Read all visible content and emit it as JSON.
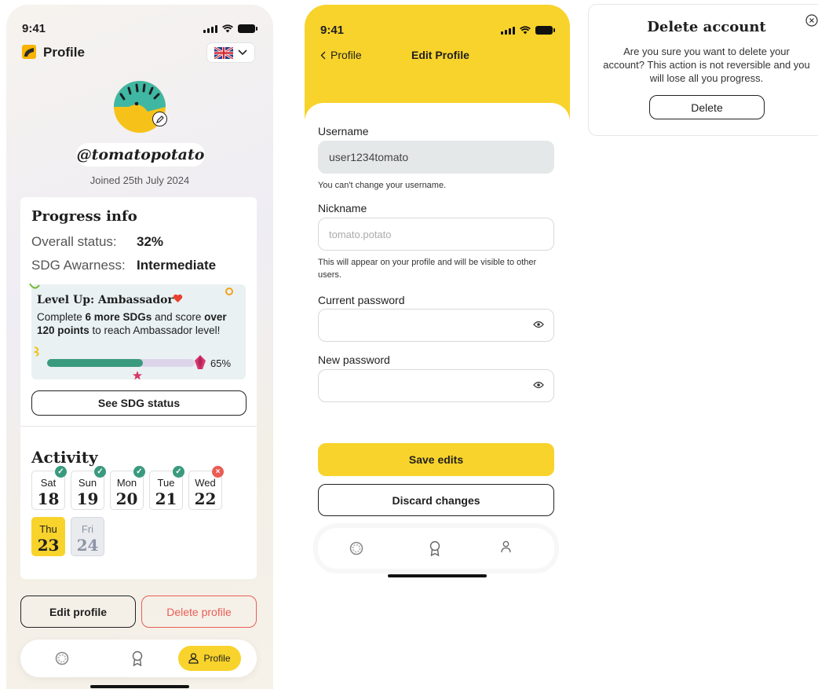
{
  "screen1": {
    "status_time": "9:41",
    "header_title": "Profile",
    "language_flag": "uk-flag-icon",
    "username": "@tomatopotato",
    "joined": "Joined 25th July 2024",
    "progress": {
      "title": "Progress info",
      "overall_label": "Overall status:",
      "overall_value": "32%",
      "awareness_label": "SDG Awarness:",
      "awareness_value": "Intermediate"
    },
    "level_card": {
      "title": "Level Up: Ambassador",
      "desc_pre": "Complete ",
      "desc_bold1": "6 more SDGs",
      "desc_mid": " and score ",
      "desc_bold2": "over 120 points",
      "desc_post": " to reach Ambassador level!",
      "percent_label": "65%",
      "progress_fraction": 0.65
    },
    "see_status_button": "See SDG status",
    "activity": {
      "title": "Activity",
      "days": [
        {
          "name": "Sat",
          "date": "18",
          "status": "done"
        },
        {
          "name": "Sun",
          "date": "19",
          "status": "done"
        },
        {
          "name": "Mon",
          "date": "20",
          "status": "done"
        },
        {
          "name": "Tue",
          "date": "21",
          "status": "done"
        },
        {
          "name": "Wed",
          "date": "22",
          "status": "missed"
        },
        {
          "name": "Thu",
          "date": "23",
          "status": "today"
        },
        {
          "name": "Fri",
          "date": "24",
          "status": "future"
        }
      ]
    },
    "edit_profile_button": "Edit profile",
    "delete_profile_button": "Delete profile",
    "tabbar": {
      "profile_label": "Profile",
      "accent": "#f8d32c"
    }
  },
  "screen2": {
    "status_time": "9:41",
    "back_label": "Profile",
    "title": "Edit Profile",
    "username_label": "Username",
    "username_value": "user1234tomato",
    "username_helper": "You can't change your username.",
    "nickname_label": "Nickname",
    "nickname_placeholder": "tomato.potato",
    "nickname_helper": "This will appear on your profile and will be visible to other users.",
    "current_password_label": "Current password",
    "new_password_label": "New password",
    "save_button": "Save edits",
    "discard_button": "Discard changes"
  },
  "modal": {
    "title": "Delete account",
    "message": "Are you sure you want to delete your account? This action is not reversible and you will lose all you progress.",
    "delete_button": "Delete"
  },
  "colors": {
    "brand_yellow": "#f8d32c",
    "teal": "#3a9a7e",
    "danger": "#ea5d55"
  }
}
